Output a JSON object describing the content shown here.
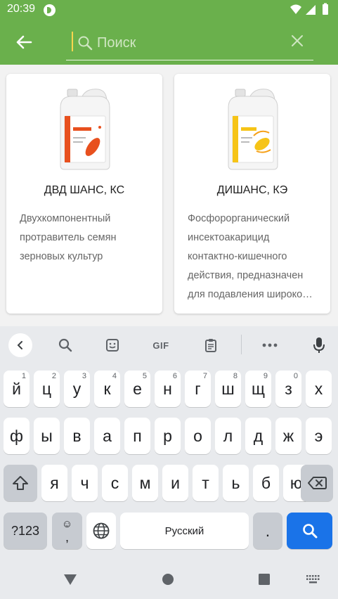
{
  "status_bar": {
    "time": "20:39",
    "icons": [
      "app-notification-icon",
      "wifi-icon",
      "signal-icon",
      "battery-icon"
    ]
  },
  "search": {
    "placeholder": "Поиск",
    "value": ""
  },
  "colors": {
    "accent": "#6ab04c",
    "cursor": "#ffd54f",
    "action_key": "#1a73e8"
  },
  "products": [
    {
      "name": "ДВД ШАНС, КС",
      "description": "Двухкомпонентный протравитель семян зерновых культур",
      "label_color": "#e8501e"
    },
    {
      "name": "ДИШАНС, КЭ",
      "description": "Фосфорорганический инсектоакарицид контактно-кишечного действия, предназначен для подавления широко…",
      "label_color": "#f6c417"
    }
  ],
  "keyboard": {
    "toolbar": {
      "gif_label": "GIF",
      "icons": [
        "collapse-icon",
        "search-icon",
        "sticker-icon",
        "gif",
        "clipboard-icon",
        "more-icon",
        "mic-icon"
      ]
    },
    "row1": [
      {
        "char": "й",
        "hint": "1"
      },
      {
        "char": "ц",
        "hint": "2"
      },
      {
        "char": "у",
        "hint": "3"
      },
      {
        "char": "к",
        "hint": "4"
      },
      {
        "char": "е",
        "hint": "5"
      },
      {
        "char": "н",
        "hint": "6"
      },
      {
        "char": "г",
        "hint": "7"
      },
      {
        "char": "ш",
        "hint": "8"
      },
      {
        "char": "щ",
        "hint": "9"
      },
      {
        "char": "з",
        "hint": "0"
      },
      {
        "char": "х",
        "hint": ""
      }
    ],
    "row2": [
      "ф",
      "ы",
      "в",
      "а",
      "п",
      "р",
      "о",
      "л",
      "д",
      "ж",
      "э"
    ],
    "row3": [
      "я",
      "ч",
      "с",
      "м",
      "и",
      "т",
      "ь",
      "б",
      "ю"
    ],
    "symbols_label": "?123",
    "emoji_top": "☺",
    "emoji_bottom": ",",
    "space_label": "Русский",
    "period_label": "."
  }
}
